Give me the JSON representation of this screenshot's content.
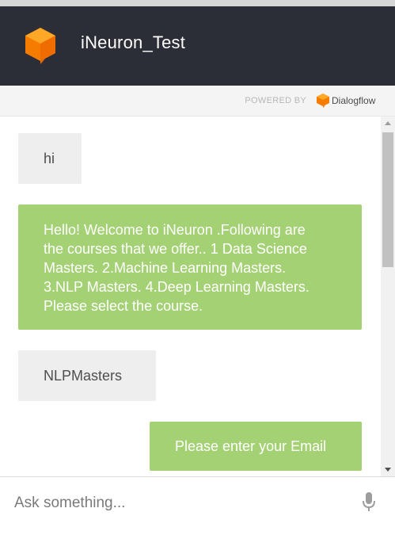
{
  "header": {
    "title": "iNeuron_Test",
    "logo_icon": "dialogflow-cube-icon",
    "background": "#2b2e37"
  },
  "powered_by": {
    "label": "POWERED BY",
    "brand": "Dialogflow",
    "brand_icon": "dialogflow-logo-icon"
  },
  "messages": [
    {
      "from": "user",
      "text": "hi"
    },
    {
      "from": "bot",
      "lines": [
        "Hello! Welcome to iNeuron .Following are",
        "the courses that we offer.. 1 Data Science",
        "Masters. 2.Machine Learning Masters.",
        "3.NLP Masters. 4.Deep Learning Masters.",
        "Please select the course."
      ]
    },
    {
      "from": "user",
      "text": "NLPMasters"
    },
    {
      "from": "bot",
      "text": "Please enter your Email"
    }
  ],
  "input": {
    "placeholder": "Ask something...",
    "value": "",
    "mic_icon": "microphone-icon"
  },
  "colors": {
    "bot_bubble": "#a5d175",
    "user_bubble": "#eeeeee",
    "brand_orange": "#ff9800"
  }
}
